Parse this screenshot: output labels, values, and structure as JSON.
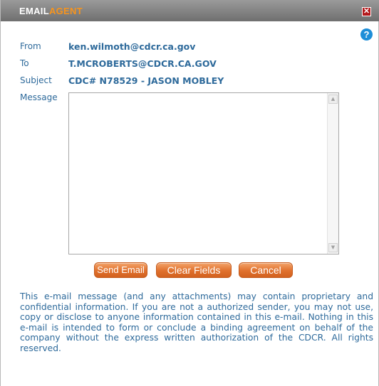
{
  "window": {
    "title_part1": "EMAIL",
    "title_part2": "AGENT",
    "close_glyph": "✕",
    "help_glyph": "?"
  },
  "form": {
    "from_label": "From",
    "from_value": "ken.wilmoth@cdcr.ca.gov",
    "to_label": "To",
    "to_value": "T.MCROBERTS@CDCR.CA.GOV",
    "subject_label": "Subject",
    "subject_value": "CDC# N78529 - JASON MOBLEY",
    "message_label": "Message",
    "message_value": ""
  },
  "buttons": {
    "send": "Send Email",
    "clear": "Clear Fields",
    "cancel": "Cancel"
  },
  "disclaimer": "This e-mail message (and any attachments) may contain proprietary and confidential information. If you are not a authorized sender, you may not use, copy or disclose to anyone information contained in this e-mail. Nothing in this e-mail is intended to form or conclude a binding agreement on behalf of the company without the express written authorization of the CDCR. All rights reserved.",
  "colors": {
    "title_accent": "#f7941d",
    "label_text": "#2e6a9b",
    "button_orange": "#e0702c",
    "close_red": "#b3191b",
    "help_blue": "#1e8ed8"
  },
  "icons": [
    "close-icon",
    "help-icon",
    "scroll-up-arrow-icon",
    "scroll-down-arrow-icon"
  ]
}
